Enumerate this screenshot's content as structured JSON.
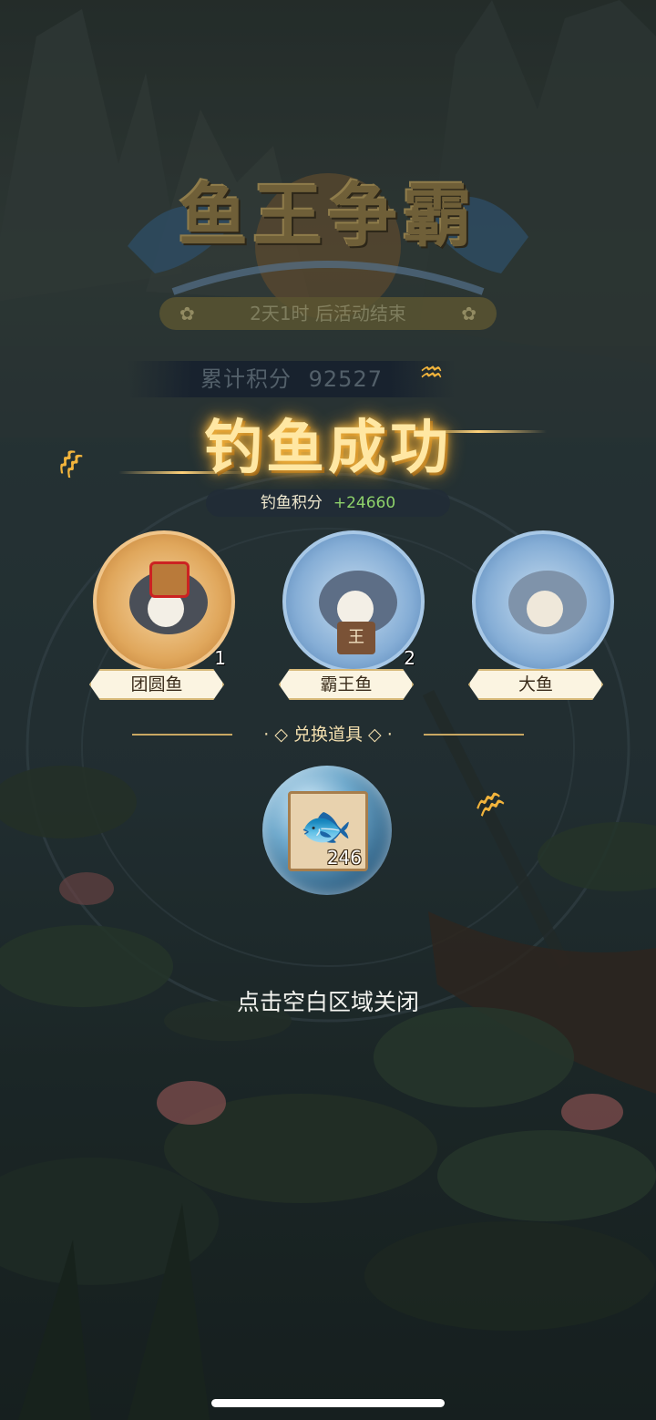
{
  "banner": {
    "title": "鱼王争霸"
  },
  "event": {
    "countdown": "2天1时 后活动结束"
  },
  "score": {
    "total_label": "累计积分",
    "total_value": "92527"
  },
  "result": {
    "title": "钓鱼成功",
    "points_label": "钓鱼积分",
    "points_value": "+24660"
  },
  "fish": [
    {
      "name": "团圆鱼",
      "count": "1"
    },
    {
      "name": "霸王鱼",
      "count": "2"
    },
    {
      "name": "大鱼",
      "count": ""
    }
  ],
  "exchange": {
    "title": "兑换道具",
    "item": {
      "count": "246",
      "icon": "golden-fish-icon"
    }
  },
  "hint": {
    "close": "点击空白区域关闭"
  },
  "colors": {
    "accent_gold": "#ffd27a",
    "points_green": "#8ed26a"
  }
}
